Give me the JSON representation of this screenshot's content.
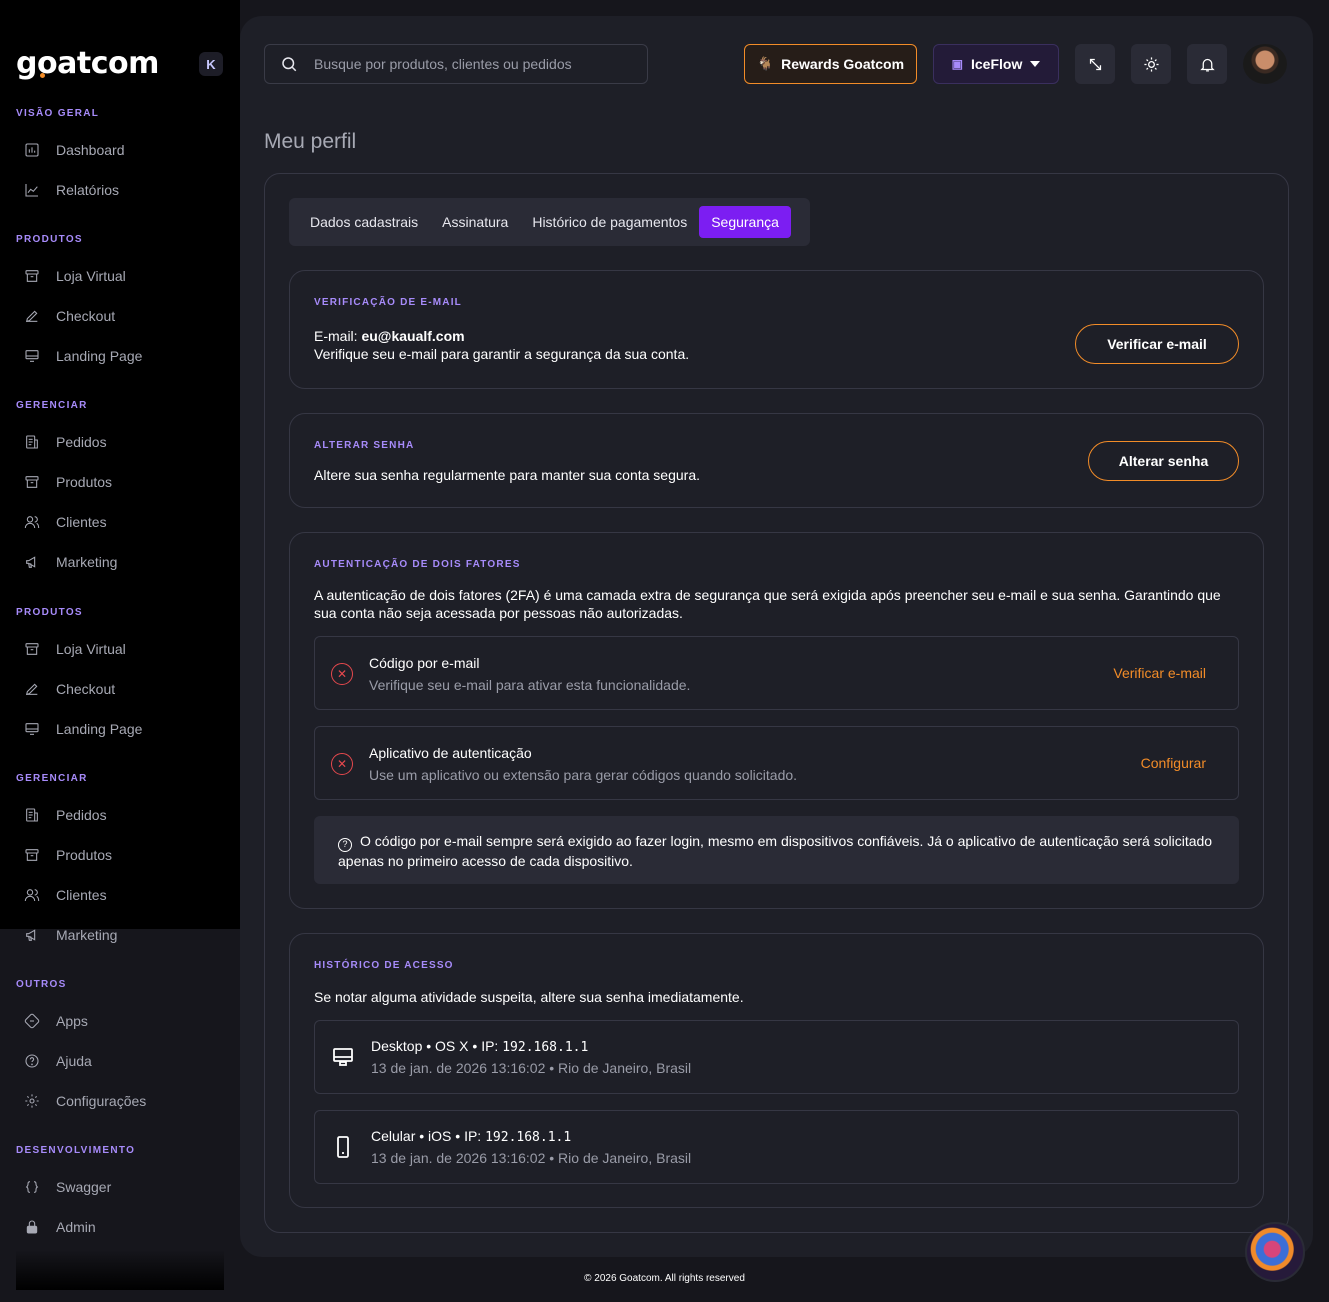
{
  "brand": {
    "logo_pre": "g",
    "logo_o": "o",
    "logo_post": "atcom",
    "accent": "#7c1ef2",
    "orange": "#f28c28"
  },
  "sidebar": {
    "collapse_label": "K",
    "sections": [
      {
        "title": "VISÃO GERAL",
        "items": [
          {
            "label": "Dashboard",
            "icon": "dashboard-icon"
          },
          {
            "label": "Relatórios",
            "icon": "chart-icon"
          }
        ]
      },
      {
        "title": "PRODUTOS",
        "items": [
          {
            "label": "Loja Virtual",
            "icon": "store-icon"
          },
          {
            "label": "Checkout",
            "icon": "edit-icon"
          },
          {
            "label": "Landing Page",
            "icon": "monitor-icon"
          }
        ]
      },
      {
        "title": "GERENCIAR",
        "items": [
          {
            "label": "Pedidos",
            "icon": "orders-icon"
          },
          {
            "label": "Produtos",
            "icon": "box-icon"
          },
          {
            "label": "Clientes",
            "icon": "users-icon"
          },
          {
            "label": "Marketing",
            "icon": "megaphone-icon"
          }
        ]
      },
      {
        "title": "PRODUTOS",
        "items": [
          {
            "label": "Loja Virtual",
            "icon": "store-icon"
          },
          {
            "label": "Checkout",
            "icon": "edit-icon"
          },
          {
            "label": "Landing Page",
            "icon": "monitor-icon"
          }
        ]
      },
      {
        "title": "GERENCIAR",
        "items": [
          {
            "label": "Pedidos",
            "icon": "orders-icon"
          },
          {
            "label": "Produtos",
            "icon": "box-icon"
          },
          {
            "label": "Clientes",
            "icon": "users-icon"
          },
          {
            "label": "Marketing",
            "icon": "megaphone-icon"
          }
        ]
      },
      {
        "title": "OUTROS",
        "items": [
          {
            "label": "Apps",
            "icon": "apps-icon"
          },
          {
            "label": "Ajuda",
            "icon": "help-icon"
          },
          {
            "label": "Configurações",
            "icon": "gear-icon"
          }
        ]
      },
      {
        "title": "DESENVOLVIMENTO",
        "items": [
          {
            "label": "Swagger",
            "icon": "code-icon"
          },
          {
            "label": "Admin",
            "icon": "lock-icon"
          }
        ]
      }
    ]
  },
  "header": {
    "search_placeholder": "Busque por produtos, clientes ou pedidos",
    "rewards_label": "Rewards Goatcom",
    "store_label": "IceFlow"
  },
  "page": {
    "title": "Meu perfil",
    "tabs": [
      {
        "label": "Dados cadastrais"
      },
      {
        "label": "Assinatura"
      },
      {
        "label": "Histórico de pagamentos"
      },
      {
        "label": "Segurança",
        "active": true
      }
    ]
  },
  "email_verification": {
    "title": "VERIFICAÇÃO DE E-MAIL",
    "email_prefix": "E-mail: ",
    "email": "eu@kaualf.com",
    "description": "Verifique seu e-mail para garantir a segurança da sua conta.",
    "button": "Verificar e-mail"
  },
  "password": {
    "title": "ALTERAR SENHA",
    "description": "Altere sua senha regularmente para manter sua conta segura.",
    "button": "Alterar senha"
  },
  "two_factor": {
    "title": "AUTENTICAÇÃO DE DOIS FATORES",
    "description": "A autenticação de dois fatores (2FA) é uma camada extra de segurança que será exigida após preencher seu e-mail e sua senha. Garantindo que sua conta não seja acessada por pessoas não autorizadas.",
    "methods": [
      {
        "title": "Código por e-mail",
        "description": "Verifique seu e-mail para ativar esta funcionalidade.",
        "action": "Verificar e-mail"
      },
      {
        "title": "Aplicativo de autenticação",
        "description": "Use um aplicativo ou extensão para gerar códigos quando solicitado.",
        "action": "Configurar"
      }
    ],
    "info": "O código por e-mail sempre será exigido ao fazer login, mesmo em dispositivos confiáveis. Já o aplicativo de autenticação será solicitado apenas no primeiro acesso de cada dispositivo."
  },
  "access_history": {
    "title": "HISTÓRICO DE ACESSO",
    "description": "Se notar alguma atividade suspeita, altere sua senha imediatamente.",
    "entries": [
      {
        "device": "Desktop",
        "os": "OS X",
        "ip_label": "IP:",
        "ip": "192.168.1.1",
        "details": "13 de jan. de 2026 13:16:02 • Rio de Janeiro, Brasil",
        "icon": "desktop-icon"
      },
      {
        "device": "Celular",
        "os": "iOS",
        "ip_label": "IP:",
        "ip": "192.168.1.1",
        "details": "13 de jan. de 2026 13:16:02 • Rio de Janeiro, Brasil",
        "icon": "phone-icon"
      }
    ]
  },
  "footer": {
    "text": "© 2026 Goatcom. All rights reserved"
  }
}
